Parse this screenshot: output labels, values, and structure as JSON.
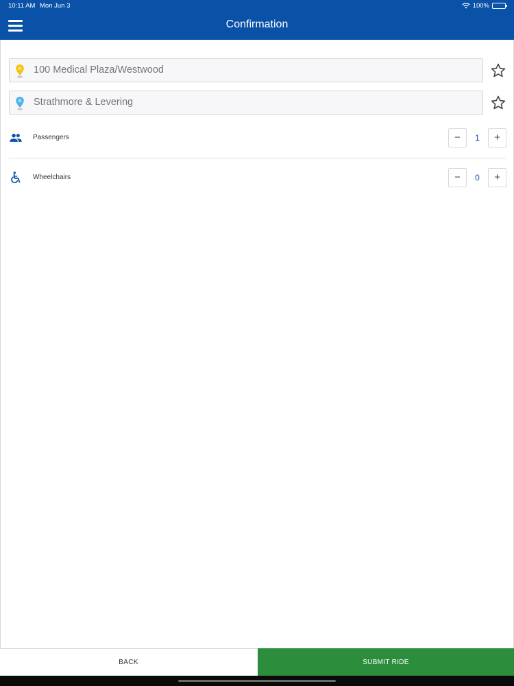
{
  "status_bar": {
    "time": "10:11 AM",
    "date": "Mon Jun 3",
    "battery": "100%",
    "battery_level": 1.0
  },
  "header": {
    "title": "Confirmation",
    "menu_icon": "hamburger-menu-icon",
    "background_color": "#0a52a8"
  },
  "pickup": {
    "placeholder": "100 Medical Plaza/Westwood",
    "pin_icon": "pickup-pin-icon",
    "pin_color": "#f2c417",
    "favorite_icon": "star-outline-icon"
  },
  "dropoff": {
    "placeholder": "Strathmore & Levering",
    "pin_icon": "dropoff-pin-icon",
    "pin_color": "#4fb3e8",
    "favorite_icon": "star-outline-icon"
  },
  "passengers": {
    "label": "Passengers",
    "icon": "people-icon",
    "value": "1",
    "minus": "−",
    "plus": "+"
  },
  "wheelchairs": {
    "label": "Wheelchairs",
    "icon": "wheelchair-icon",
    "value": "0",
    "minus": "−",
    "plus": "+"
  },
  "footer": {
    "back_label": "BACK",
    "submit_label": "SUBMIT RIDE",
    "submit_color": "#2c8e3d"
  }
}
